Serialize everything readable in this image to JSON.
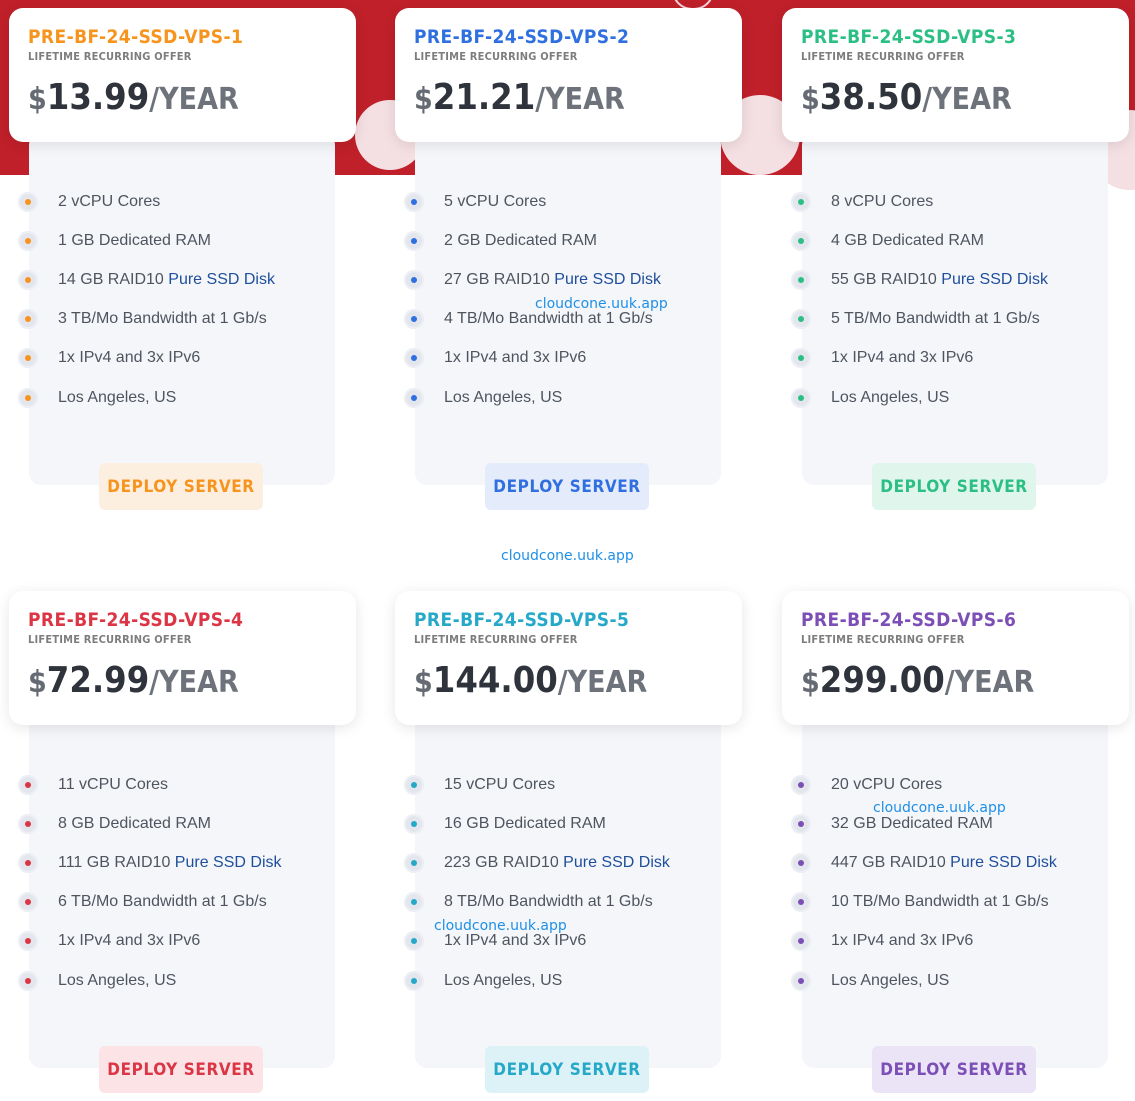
{
  "brand_watermarks": [
    "cloudcone.uuk.app",
    "cloudcone.uuk.app",
    "cloudcone.uuk.app",
    "cloudcone.uuk.app"
  ],
  "plans": [
    {
      "name": "PRE-BF-24-SSD-VPS-1",
      "offer": "LIFETIME RECURRING OFFER",
      "currency": "$",
      "amount": "13.99",
      "period": "/YEAR",
      "accent": "#f7941d",
      "btn_bg": "#fdefdf",
      "features": [
        {
          "text": "2 vCPU Cores"
        },
        {
          "text": "1 GB Dedicated RAM"
        },
        {
          "text": "14 GB RAID10 ",
          "highlight": "Pure SSD Disk"
        },
        {
          "text": "3 TB/Mo Bandwidth at 1 Gb/s"
        },
        {
          "text": "1x IPv4 and 3x IPv6"
        },
        {
          "text": "Los Angeles, US"
        }
      ],
      "button": "DEPLOY SERVER"
    },
    {
      "name": "PRE-BF-24-SSD-VPS-2",
      "offer": "LIFETIME RECURRING OFFER",
      "currency": "$",
      "amount": "21.21",
      "period": "/YEAR",
      "accent": "#2f6fe0",
      "btn_bg": "#e4ebfa",
      "features": [
        {
          "text": "5 vCPU Cores"
        },
        {
          "text": "2 GB Dedicated RAM"
        },
        {
          "text": "27 GB RAID10 ",
          "highlight": "Pure SSD Disk"
        },
        {
          "text": "4 TB/Mo Bandwidth at 1 Gb/s"
        },
        {
          "text": "1x IPv4 and 3x IPv6"
        },
        {
          "text": "Los Angeles, US"
        }
      ],
      "button": "DEPLOY SERVER"
    },
    {
      "name": "PRE-BF-24-SSD-VPS-3",
      "offer": "LIFETIME RECURRING OFFER",
      "currency": "$",
      "amount": "38.50",
      "period": "/YEAR",
      "accent": "#2bbf84",
      "btn_bg": "#e0f5ec",
      "features": [
        {
          "text": "8 vCPU Cores"
        },
        {
          "text": "4 GB Dedicated RAM"
        },
        {
          "text": "55 GB RAID10 ",
          "highlight": "Pure SSD Disk"
        },
        {
          "text": "5 TB/Mo Bandwidth at 1 Gb/s"
        },
        {
          "text": "1x IPv4 and 3x IPv6"
        },
        {
          "text": "Los Angeles, US"
        }
      ],
      "button": "DEPLOY SERVER"
    },
    {
      "name": "PRE-BF-24-SSD-VPS-4",
      "offer": "LIFETIME RECURRING OFFER",
      "currency": "$",
      "amount": "72.99",
      "period": "/YEAR",
      "accent": "#dc3545",
      "btn_bg": "#fbe3e6",
      "features": [
        {
          "text": "11 vCPU Cores"
        },
        {
          "text": "8 GB Dedicated RAM"
        },
        {
          "text": "111 GB RAID10 ",
          "highlight": "Pure SSD Disk"
        },
        {
          "text": "6 TB/Mo Bandwidth at 1 Gb/s"
        },
        {
          "text": "1x IPv4 and 3x IPv6"
        },
        {
          "text": "Los Angeles, US"
        }
      ],
      "button": "DEPLOY SERVER"
    },
    {
      "name": "PRE-BF-24-SSD-VPS-5",
      "offer": "LIFETIME RECURRING OFFER",
      "currency": "$",
      "amount": "144.00",
      "period": "/YEAR",
      "accent": "#26a9c9",
      "btn_bg": "#ddf2f6",
      "features": [
        {
          "text": "15 vCPU Cores"
        },
        {
          "text": "16 GB Dedicated RAM"
        },
        {
          "text": "223 GB RAID10 ",
          "highlight": "Pure SSD Disk"
        },
        {
          "text": "8 TB/Mo Bandwidth at 1 Gb/s"
        },
        {
          "text": "1x IPv4 and 3x IPv6"
        },
        {
          "text": "Los Angeles, US"
        }
      ],
      "button": "DEPLOY SERVER"
    },
    {
      "name": "PRE-BF-24-SSD-VPS-6",
      "offer": "LIFETIME RECURRING OFFER",
      "currency": "$",
      "amount": "299.00",
      "period": "/YEAR",
      "accent": "#7b4fb5",
      "btn_bg": "#ebe3f6",
      "features": [
        {
          "text": "20 vCPU Cores"
        },
        {
          "text": "32 GB Dedicated RAM"
        },
        {
          "text": "447 GB RAID10 ",
          "highlight": "Pure SSD Disk"
        },
        {
          "text": "10 TB/Mo Bandwidth at 1 Gb/s"
        },
        {
          "text": "1x IPv4 and 3x IPv6"
        },
        {
          "text": "Los Angeles, US"
        }
      ],
      "button": "DEPLOY SERVER"
    }
  ]
}
